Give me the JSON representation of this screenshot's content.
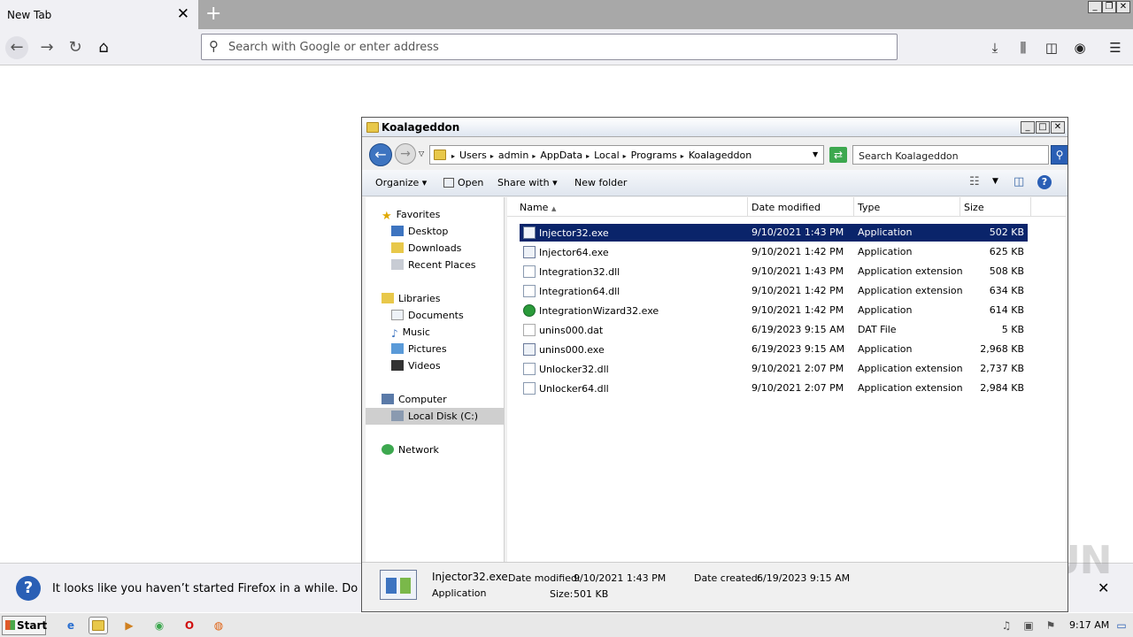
{
  "browser": {
    "tab_title": "New Tab",
    "url_placeholder": "Search with Google or enter address"
  },
  "notification": {
    "text": "It looks like you haven’t started Firefox in a while. Do you wa"
  },
  "explorer": {
    "title": "Koalageddon",
    "breadcrumb": [
      "Users",
      "admin",
      "AppData",
      "Local",
      "Programs",
      "Koalageddon"
    ],
    "search_placeholder": "Search Koalageddon",
    "toolbar": {
      "organize": "Organize",
      "open": "Open",
      "share_with": "Share with",
      "new_folder": "New folder"
    },
    "nav": {
      "favorites": "Favorites",
      "desktop": "Desktop",
      "downloads": "Downloads",
      "recent_places": "Recent Places",
      "libraries": "Libraries",
      "documents": "Documents",
      "music": "Music",
      "pictures": "Pictures",
      "videos": "Videos",
      "computer": "Computer",
      "local_disk": "Local Disk (C:)",
      "network": "Network"
    },
    "columns": {
      "name": "Name",
      "date": "Date modified",
      "type": "Type",
      "size": "Size"
    },
    "files": [
      {
        "name": "Injector32.exe",
        "date": "9/10/2021 1:43 PM",
        "type": "Application",
        "size": "502 KB"
      },
      {
        "name": "Injector64.exe",
        "date": "9/10/2021 1:42 PM",
        "type": "Application",
        "size": "625 KB"
      },
      {
        "name": "Integration32.dll",
        "date": "9/10/2021 1:43 PM",
        "type": "Application extension",
        "size": "508 KB"
      },
      {
        "name": "Integration64.dll",
        "date": "9/10/2021 1:42 PM",
        "type": "Application extension",
        "size": "634 KB"
      },
      {
        "name": "IntegrationWizard32.exe",
        "date": "9/10/2021 1:42 PM",
        "type": "Application",
        "size": "614 KB"
      },
      {
        "name": "unins000.dat",
        "date": "6/19/2023 9:15 AM",
        "type": "DAT File",
        "size": "5 KB"
      },
      {
        "name": "unins000.exe",
        "date": "6/19/2023 9:15 AM",
        "type": "Application",
        "size": "2,968 KB"
      },
      {
        "name": "Unlocker32.dll",
        "date": "9/10/2021 2:07 PM",
        "type": "Application extension",
        "size": "2,737 KB"
      },
      {
        "name": "Unlocker64.dll",
        "date": "9/10/2021 2:07 PM",
        "type": "Application extension",
        "size": "2,984 KB"
      }
    ],
    "details": {
      "name": "Injector32.exe",
      "type": "Application",
      "date_modified_label": "Date modified:",
      "date_modified": "9/10/2021 1:43 PM",
      "size_label": "Size:",
      "size": "501 KB",
      "date_created_label": "Date created:",
      "date_created": "6/19/2023 9:15 AM"
    }
  },
  "taskbar": {
    "start": "Start",
    "clock": "9:17 AM"
  },
  "watermark": "ANY RUN"
}
